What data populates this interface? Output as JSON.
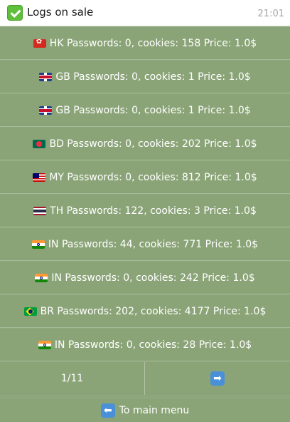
{
  "header": {
    "title": "Logs on sale",
    "time": "21:01",
    "icon": "check-mark-icon",
    "icon_color": "#5fbf3a"
  },
  "listings": [
    {
      "flag": "hk-flag-icon",
      "label": "HK Passwords: 0, cookies: 158 Price: 1.0$"
    },
    {
      "flag": "gb-flag-icon",
      "label": "GB Passwords: 0, cookies: 1 Price: 1.0$"
    },
    {
      "flag": "gb-flag-icon",
      "label": "GB Passwords: 0, cookies: 1 Price: 1.0$"
    },
    {
      "flag": "bd-flag-icon",
      "label": "BD Passwords: 0, cookies: 202 Price: 1.0$"
    },
    {
      "flag": "my-flag-icon",
      "label": "MY Passwords: 0, cookies: 812 Price: 1.0$"
    },
    {
      "flag": "th-flag-icon",
      "label": "TH Passwords: 122, cookies: 3 Price: 1.0$"
    },
    {
      "flag": "in-flag-icon",
      "label": "IN Passwords: 44, cookies: 771 Price: 1.0$"
    },
    {
      "flag": "in-flag-icon",
      "label": "IN Passwords: 0, cookies: 242 Price: 1.0$"
    },
    {
      "flag": "br-flag-icon",
      "label": "BR Passwords: 202, cookies: 4177 Price: 1.0$"
    },
    {
      "flag": "in-flag-icon",
      "label": "IN Passwords: 0, cookies: 28 Price: 1.0$"
    }
  ],
  "pagination": {
    "page": "1/11",
    "next_icon": "right-arrow-icon"
  },
  "footer": {
    "main_menu_label": "To main menu",
    "back_icon": "left-arrow-icon"
  },
  "colors": {
    "background": "#8fa77c",
    "button_text": "#ffffff",
    "arrow_button": "#4a90d9"
  }
}
